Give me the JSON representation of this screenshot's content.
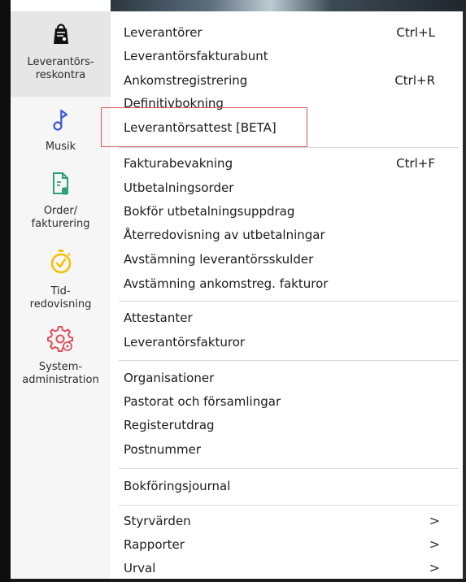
{
  "sidebar": {
    "items": [
      {
        "label": "Leverantörs-\nreskontra",
        "icon": "ledger-bag-icon",
        "active": true
      },
      {
        "label": "Musik",
        "icon": "music-note-icon",
        "active": false
      },
      {
        "label": "Order/\nfakturering",
        "icon": "invoice-document-icon",
        "active": false
      },
      {
        "label": "Tid-\nredovisning",
        "icon": "stopwatch-icon",
        "active": false
      },
      {
        "label": "System-\nadministration",
        "icon": "gear-icon",
        "active": false
      }
    ]
  },
  "menu": {
    "items": [
      {
        "label": "Leverantörer",
        "shortcut": "Ctrl+L"
      },
      {
        "label": "Leverantörsfakturabunt",
        "shortcut": ""
      },
      {
        "label": "Ankomstregistrering",
        "shortcut": "Ctrl+R"
      },
      {
        "label": "Definitivbokning",
        "shortcut": ""
      },
      {
        "label": "Leverantörsattest [BETA]",
        "shortcut": "",
        "highlighted": true
      },
      {
        "label": "Fakturabevakning",
        "shortcut": "Ctrl+F"
      },
      {
        "label": "Utbetalningsorder",
        "shortcut": ""
      },
      {
        "label": "Bokför utbetalningsuppdrag",
        "shortcut": ""
      },
      {
        "label": "Återredovisning av utbetalningar",
        "shortcut": ""
      },
      {
        "label": "Avstämning leverantörsskulder",
        "shortcut": ""
      },
      {
        "label": "Avstämning ankomstreg. fakturor",
        "shortcut": ""
      },
      {
        "label": "Attestanter",
        "shortcut": ""
      },
      {
        "label": "Leverantörsfakturor",
        "shortcut": ""
      },
      {
        "label": "Organisationer",
        "shortcut": ""
      },
      {
        "label": "Pastorat och församlingar",
        "shortcut": ""
      },
      {
        "label": "Registerutdrag",
        "shortcut": ""
      },
      {
        "label": "Postnummer",
        "shortcut": ""
      },
      {
        "label": "Bokföringsjournal",
        "shortcut": ""
      },
      {
        "label": "Styrvärden",
        "shortcut": "",
        "submenu": true
      },
      {
        "label": "Rapporter",
        "shortcut": "",
        "submenu": true
      },
      {
        "label": "Urval",
        "shortcut": "",
        "submenu": true
      }
    ],
    "submenu_arrow": ">"
  },
  "colors": {
    "highlight_border": "#d9575b",
    "icon_blue": "#3f56d8",
    "icon_green": "#2aa37a",
    "icon_yellow": "#f2c10b",
    "icon_red": "#e0505a"
  }
}
